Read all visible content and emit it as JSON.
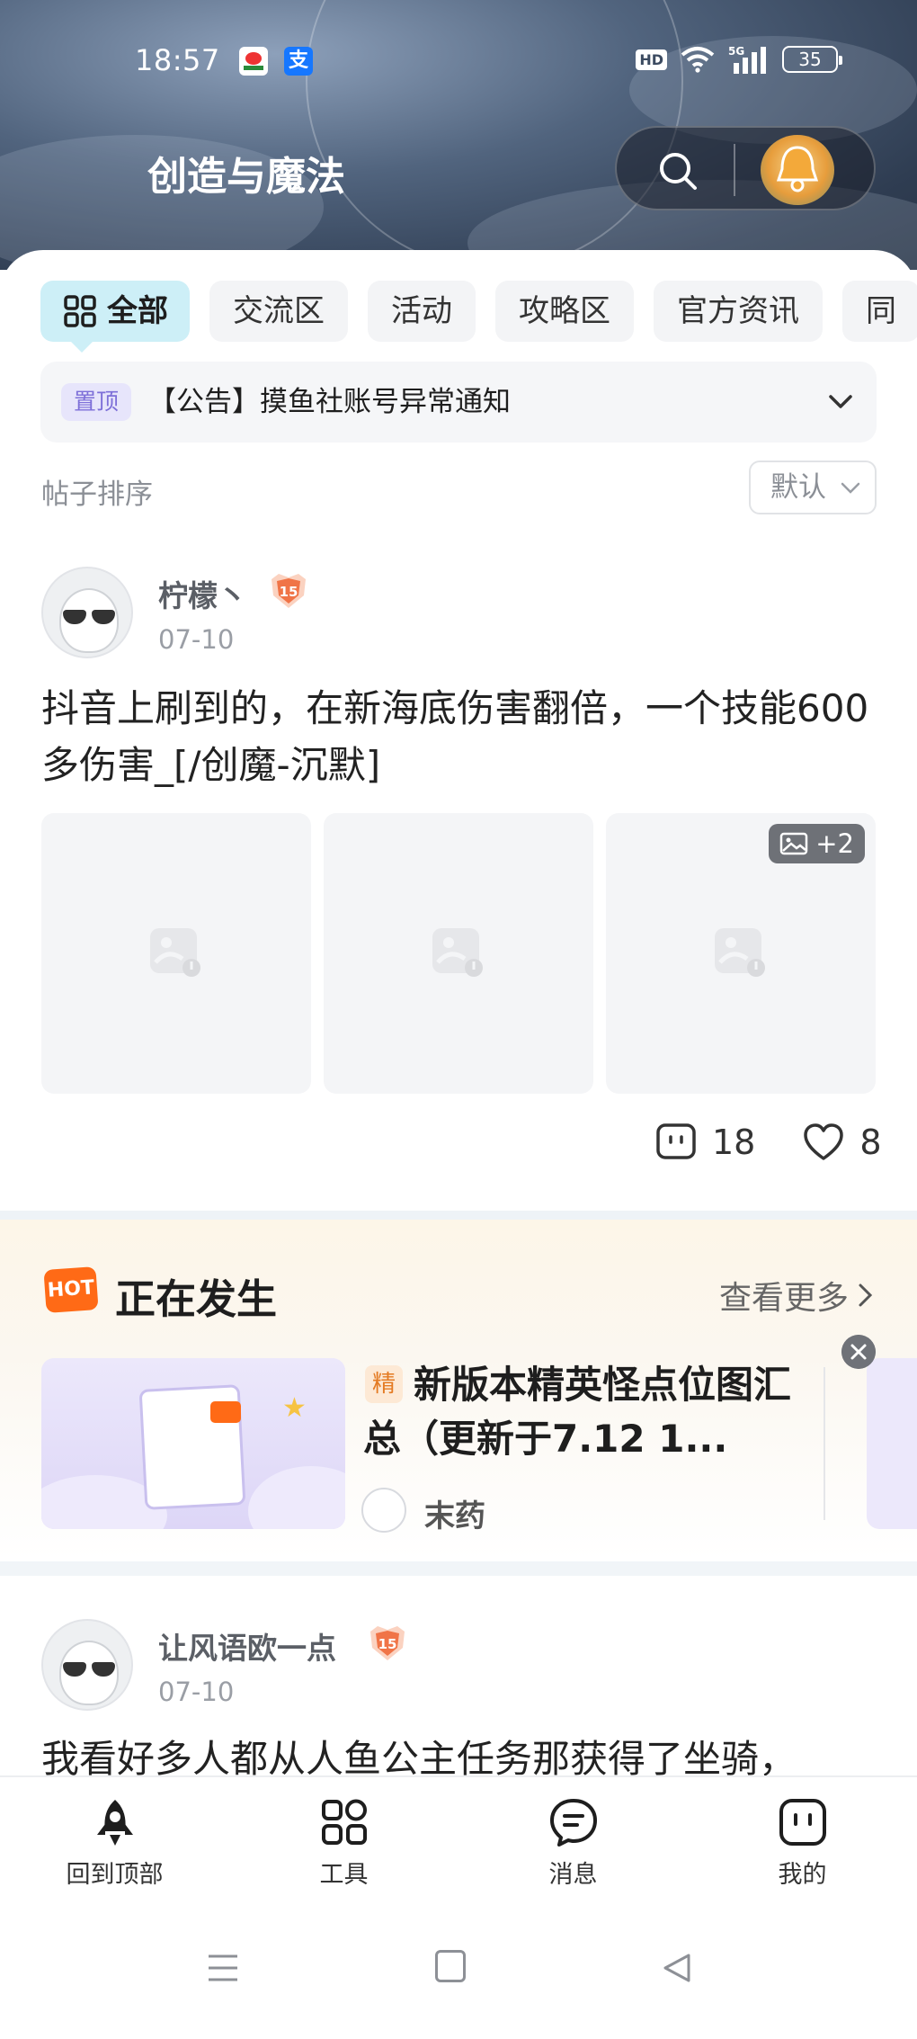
{
  "status_bar": {
    "time": "18:57",
    "alipay_glyph": "支",
    "hd": "HD",
    "network": "5G",
    "battery": "35"
  },
  "header": {
    "title": "创造与魔法"
  },
  "tabs": [
    {
      "label": "全部",
      "active": true
    },
    {
      "label": "交流区"
    },
    {
      "label": "活动"
    },
    {
      "label": "攻略区"
    },
    {
      "label": "官方资讯"
    },
    {
      "label": "同"
    }
  ],
  "notice": {
    "pin_label": "置顶",
    "text": "【公告】摸鱼社账号异常通知"
  },
  "sort": {
    "label": "帖子排序",
    "value": "默认"
  },
  "post1": {
    "username": "柠檬丶",
    "level": "15",
    "date": "07-10",
    "text": "抖音上刷到的，在新海底伤害翻倍，一个技能600多伤害_[/创魔-沉默]",
    "more_images": "+2",
    "comments": "18",
    "likes": "8"
  },
  "happening": {
    "title": "正在发生",
    "hot_label": "HOT",
    "see_more": "查看更多",
    "card": {
      "essence_tag": "精",
      "headline": "新版本精英怪点位图汇总（更新于7.12 1...",
      "author": "末药"
    }
  },
  "post2": {
    "username": "让风语欧一点",
    "level": "15",
    "date": "07-10",
    "text": "我看好多人都从人鱼公主任务那获得了坐骑，"
  },
  "bottom_nav": [
    {
      "label": "回到顶部",
      "icon": "rocket-icon"
    },
    {
      "label": "工具",
      "icon": "tools-grid-icon"
    },
    {
      "label": "消息",
      "icon": "message-icon"
    },
    {
      "label": "我的",
      "icon": "profile-icon"
    }
  ],
  "colors": {
    "accent_tab": "#cdeff7",
    "hot_orange": "#ff6a16",
    "pin_purple": "#7d6fd8"
  }
}
